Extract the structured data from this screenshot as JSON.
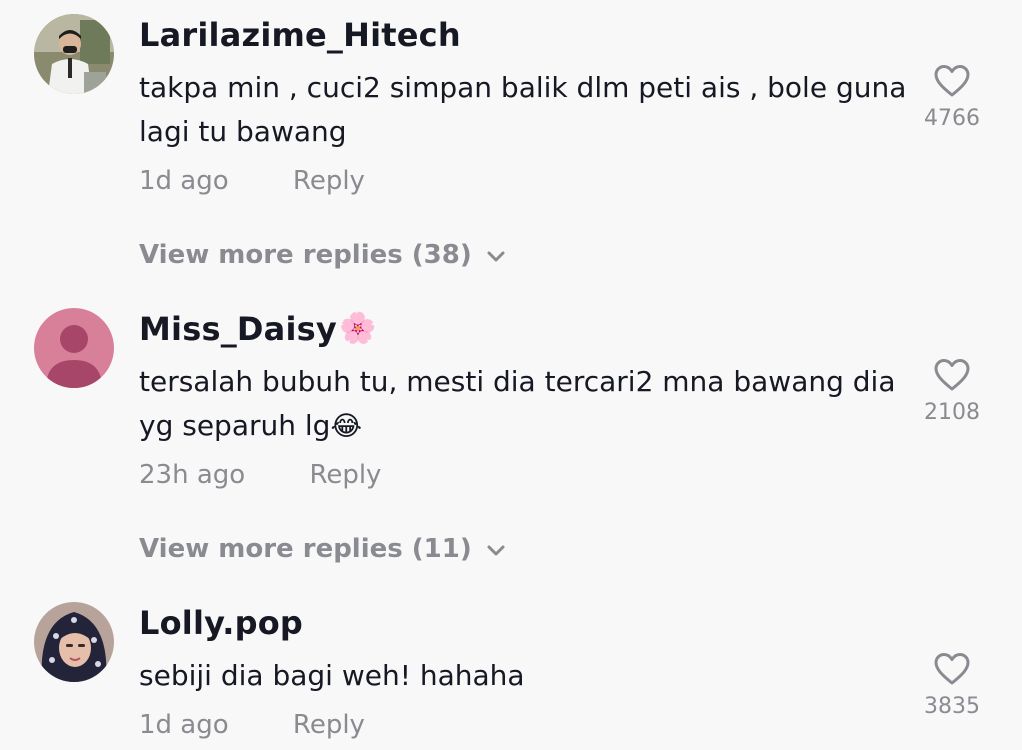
{
  "comments": [
    {
      "username": "Larilazime_Hitech",
      "text": "takpa min , cuci2 simpan balik dlm peti ais , bole guna lagi tu bawang",
      "time": "1d ago",
      "reply_label": "Reply",
      "likes": "4766",
      "view_more": "View more replies (38)",
      "icons": {
        "avatar": "avatar-photo",
        "like": "heart-outline-icon",
        "chevron": "chevron-down-icon"
      }
    },
    {
      "username": "Miss_Daisy",
      "username_emoji": "🌸",
      "text": "tersalah bubuh tu, mesti dia tercari2 mna bawang dia yg separuh lg",
      "text_emoji": "😂",
      "time": "23h ago",
      "reply_label": "Reply",
      "likes": "2108",
      "view_more": "View more replies (11)",
      "icons": {
        "avatar": "default-user-avatar",
        "like": "heart-outline-icon",
        "chevron": "chevron-down-icon"
      }
    },
    {
      "username": "Lolly.pop",
      "text": "sebiji dia bagi weh! hahaha",
      "time": "1d ago",
      "reply_label": "Reply",
      "likes": "3835",
      "icons": {
        "avatar": "avatar-photo",
        "like": "heart-outline-icon"
      }
    }
  ],
  "colors": {
    "background": "#f8f8f8",
    "primary_text": "#161823",
    "secondary_text": "#8a8b91",
    "default_avatar_bg": "#d8809a",
    "default_avatar_fg": "#a8466a"
  }
}
